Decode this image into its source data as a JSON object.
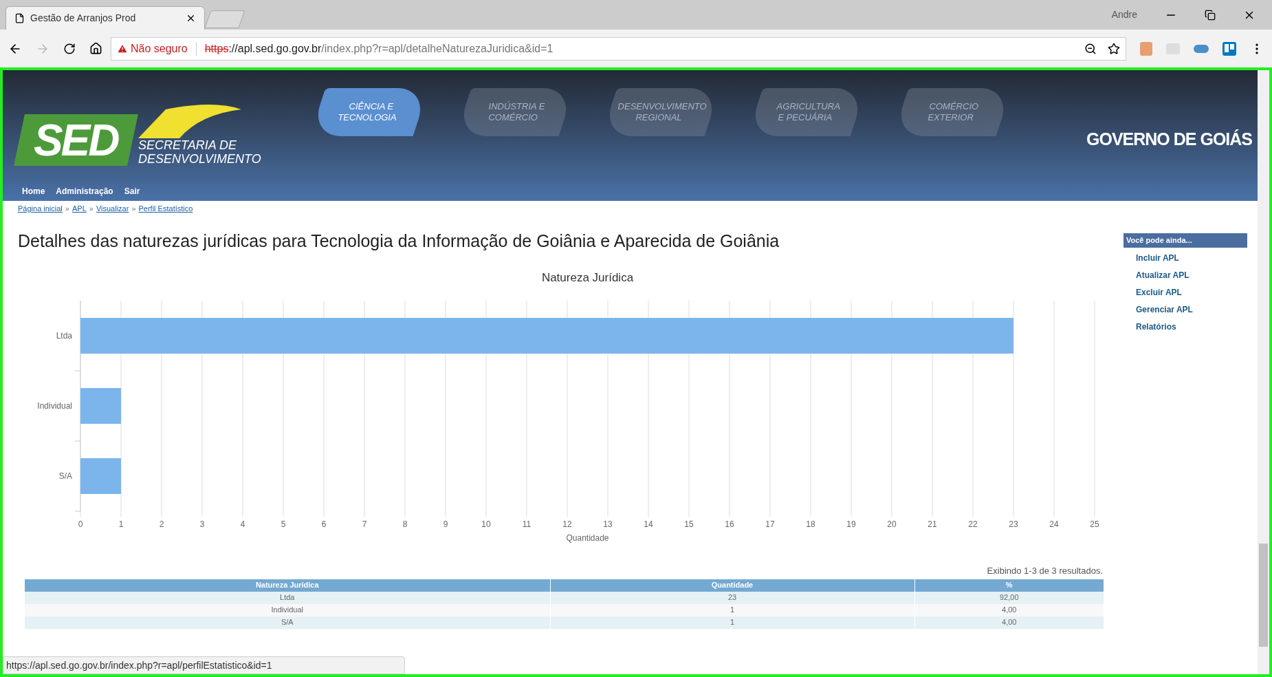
{
  "browser": {
    "tab": {
      "title": "Gestão de Arranjos Prod"
    },
    "profile": "Andre",
    "security": "Não seguro",
    "url": {
      "scheme": "https",
      "host": "://apl.sed.go.gov.br",
      "path": "/index.php?r=apl/detalheNaturezaJuridica&id=1"
    }
  },
  "header": {
    "logo": "SED",
    "logo_subtitle": [
      "SECRETARIA DE",
      "DESENVOLVIMENTO"
    ],
    "sectors": [
      {
        "lines": [
          "CIÊNCIA E",
          "TECNOLOGIA"
        ],
        "selected": true
      },
      {
        "lines": [
          "INDÚSTRIA E",
          "COMÉRCIO"
        ],
        "selected": false
      },
      {
        "lines": [
          "DESENVOLVIMENTO",
          "REGIONAL"
        ],
        "selected": false
      },
      {
        "lines": [
          "AGRICULTURA",
          "E PECUÁRIA"
        ],
        "selected": false
      },
      {
        "lines": [
          "COMÉRCIO",
          "EXTERIOR"
        ],
        "selected": false
      }
    ],
    "government": "GOVERNO DE GOIÁS",
    "nav": [
      "Home",
      "Administração",
      "Sair"
    ]
  },
  "breadcrumb": {
    "separator": "»",
    "items": [
      "Página inicial",
      "APL",
      "Visualizar",
      "Perfil Estatístico"
    ]
  },
  "title": "Detalhes das naturezas jurídicas para Tecnologia da Informação de Goiânia e Aparecida de Goiânia",
  "chart_data": {
    "type": "bar",
    "orientation": "horizontal",
    "grid": true,
    "title": "Natureza Jurídica",
    "xlabel": "Quantidade",
    "categories": [
      "Ltda",
      "Individual",
      "S/A"
    ],
    "values": [
      23,
      1,
      1
    ],
    "xlim": [
      0,
      25
    ],
    "xticks": [
      0,
      1,
      2,
      3,
      4,
      5,
      6,
      7,
      8,
      9,
      10,
      11,
      12,
      13,
      14,
      15,
      16,
      17,
      18,
      19,
      20,
      21,
      22,
      23,
      24,
      25
    ]
  },
  "summary": "Exibindo 1-3 de 3 resultados.",
  "table": {
    "columns": [
      "Natureza Jurídica",
      "Quantidade",
      "%"
    ],
    "rows": [
      [
        "Ltda",
        "23",
        "92,00"
      ],
      [
        "Individual",
        "1",
        "4,00"
      ],
      [
        "S/A",
        "1",
        "4,00"
      ]
    ]
  },
  "sidebar": {
    "title": "Você pode ainda...",
    "links": [
      "Incluir APL",
      "Atualizar APL",
      "Excluir APL",
      "Gerenciar APL",
      "Relatórios"
    ]
  },
  "status_url": "https://apl.sed.go.gov.br/index.php?r=apl/perfilEstatistico&id=1"
}
